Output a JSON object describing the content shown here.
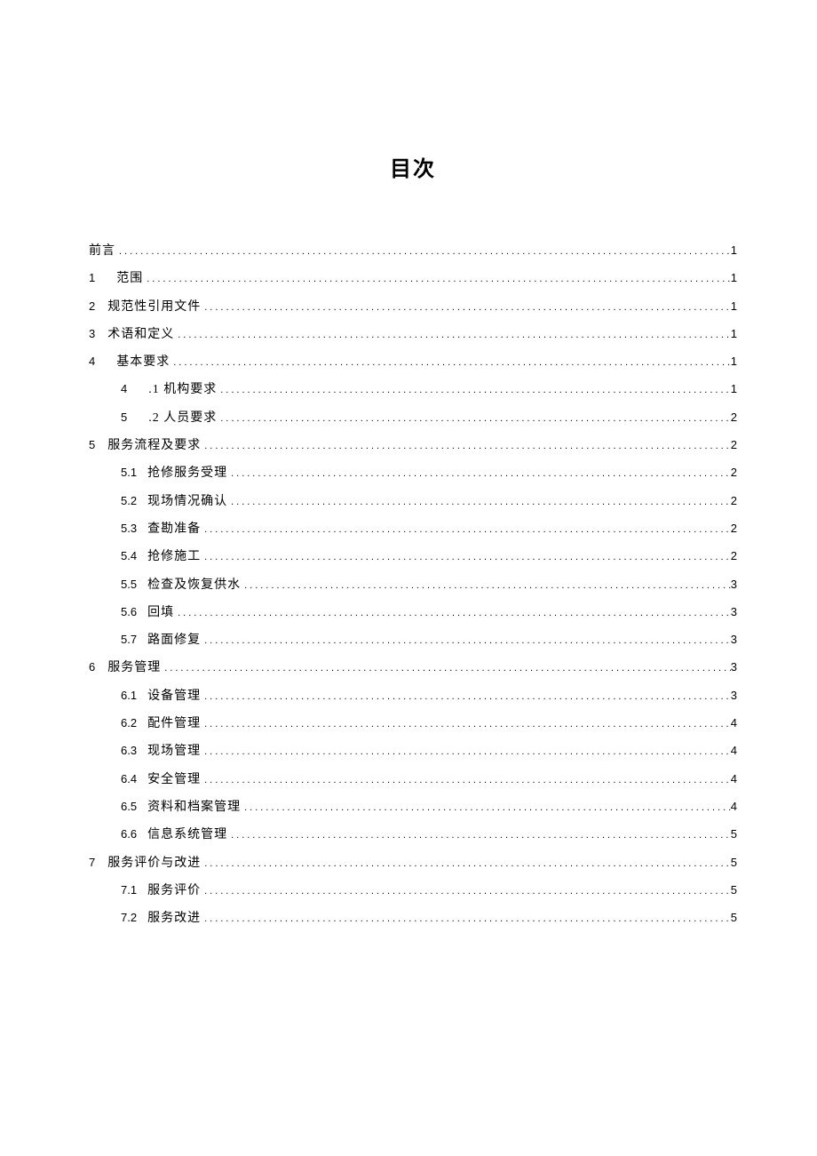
{
  "title": "目次",
  "entries": [
    {
      "level": 0,
      "num": "",
      "label": "前言",
      "page": "1",
      "spaced": false
    },
    {
      "level": 0,
      "num": "1",
      "label": "范围",
      "page": "1",
      "spaced": true
    },
    {
      "level": 0,
      "num": "2",
      "label": "规范性引用文件",
      "page": "1",
      "spaced": false
    },
    {
      "level": 0,
      "num": "3",
      "label": "术语和定义",
      "page": "1",
      "spaced": false
    },
    {
      "level": 0,
      "num": "4",
      "label": "基本要求",
      "page": "1",
      "spaced": true
    },
    {
      "level": 1,
      "num": "4",
      "label": ".1 机构要求",
      "page": "1",
      "spaced": true
    },
    {
      "level": 1,
      "num": "5",
      "label": ".2 人员要求",
      "page": "2",
      "spaced": true
    },
    {
      "level": 0,
      "num": "5",
      "label": "服务流程及要求",
      "page": "2",
      "spaced": false
    },
    {
      "level": 1,
      "num": "5.1",
      "label": "抢修服务受理",
      "page": "2",
      "spaced": false
    },
    {
      "level": 1,
      "num": "5.2",
      "label": "现场情况确认",
      "page": "2",
      "spaced": false
    },
    {
      "level": 1,
      "num": "5.3",
      "label": "查勘准备",
      "page": "2",
      "spaced": false
    },
    {
      "level": 1,
      "num": "5.4",
      "label": "抢修施工",
      "page": "2",
      "spaced": false
    },
    {
      "level": 1,
      "num": "5.5",
      "label": "检查及恢复供水",
      "page": "3",
      "spaced": false
    },
    {
      "level": 1,
      "num": "5.6",
      "label": "回填",
      "page": "3",
      "spaced": false
    },
    {
      "level": 1,
      "num": "5.7",
      "label": "路面修复",
      "page": "3",
      "spaced": false
    },
    {
      "level": 0,
      "num": "6",
      "label": "服务管理",
      "page": "3",
      "spaced": false
    },
    {
      "level": 1,
      "num": "6.1",
      "label": "设备管理",
      "page": "3",
      "spaced": false
    },
    {
      "level": 1,
      "num": "6.2",
      "label": "配件管理",
      "page": "4",
      "spaced": false
    },
    {
      "level": 1,
      "num": "6.3",
      "label": "现场管理",
      "page": "4",
      "spaced": false
    },
    {
      "level": 1,
      "num": "6.4",
      "label": "安全管理",
      "page": "4",
      "spaced": false
    },
    {
      "level": 1,
      "num": "6.5",
      "label": "资料和档案管理",
      "page": "4",
      "spaced": false
    },
    {
      "level": 1,
      "num": "6.6",
      "label": "信息系统管理",
      "page": "5",
      "spaced": false
    },
    {
      "level": 0,
      "num": "7",
      "label": "服务评价与改进",
      "page": "5",
      "spaced": false
    },
    {
      "level": 1,
      "num": "7.1",
      "label": "服务评价",
      "page": "5",
      "spaced": false
    },
    {
      "level": 1,
      "num": "7.2",
      "label": "服务改进",
      "page": "5",
      "spaced": false
    }
  ]
}
